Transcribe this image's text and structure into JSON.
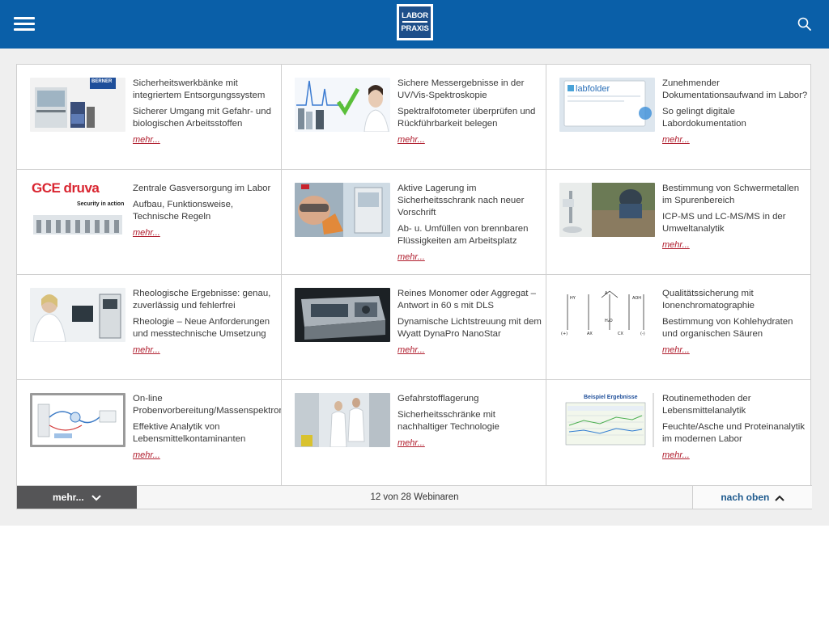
{
  "header": {
    "menu_icon": "hamburger-menu-icon",
    "logo_line1": "LABOR",
    "logo_line2": "PRAXIS",
    "search_icon": "search-icon",
    "color": "#0a5fa8"
  },
  "webinars": [
    {
      "title": "Sicherheitswerkbänke mit integriertem Entsorgungssystem",
      "subtitle": "Sicherer Umgang mit Gefahr- und biologischen Arbeitsstoffen",
      "more": "mehr...",
      "image_badge": "BERNER"
    },
    {
      "title": "Sichere Messergebnisse in der UV/Vis-Spektroskopie",
      "subtitle": "Spektralfotometer überprüfen und Rückführbarkeit belegen",
      "more": "mehr..."
    },
    {
      "title": "Zunehmender Dokumentationsaufwand im Labor?",
      "subtitle": "So gelingt digitale Labordokumentation",
      "more": "mehr...",
      "image_badge": "labfolder"
    },
    {
      "title": "Zentrale Gasversorgung im Labor",
      "subtitle": "Aufbau, Funktionsweise, Technische Regeln",
      "more": "mehr...",
      "image_badge": "GCE druva",
      "image_tagline": "Security in action"
    },
    {
      "title": "Aktive Lagerung im Sicherheitsschrank nach neuer Vorschrift",
      "subtitle": "Ab- u. Umfüllen von brennbaren Flüssigkeiten am Arbeitsplatz",
      "more": "mehr..."
    },
    {
      "title": "Bestimmung von Schwermetallen im Spurenbereich",
      "subtitle": "ICP-MS und LC-MS/MS in der Umweltanalytik",
      "more": "mehr..."
    },
    {
      "title": "Rheologische Ergebnisse: genau, zuverlässig und fehlerfrei",
      "subtitle": "Rheologie – Neue Anforderungen und messtechnische Umsetzung",
      "more": "mehr..."
    },
    {
      "title": "Reines Monomer oder Aggregat – Antwort in 60 s mit DLS",
      "subtitle": "Dynamische Lichtstreuung mit dem Wyatt DynaPro NanoStar",
      "more": "mehr..."
    },
    {
      "title": "Qualitätssicherung mit Ionenchromatographie",
      "subtitle": "Bestimmung von Kohlehydraten und organischen Säuren",
      "more": "mehr..."
    },
    {
      "title": "On-line Probenvorbereitung/Massenspektrometrie",
      "subtitle": "Effektive Analytik von Lebensmittelkontaminanten",
      "more": "mehr..."
    },
    {
      "title": "Gefahrstofflagerung",
      "subtitle": "Sicherheitsschränke mit nachhaltiger Technologie",
      "more": "mehr..."
    },
    {
      "title": "Routinemethoden der Lebensmittelanalytik",
      "subtitle": "Feuchte/Asche und Proteinanalytik im modernen Labor",
      "more": "mehr...",
      "image_badge": "Beispiel Ergebnisse"
    }
  ],
  "footer": {
    "more_label": "mehr...",
    "count_text": "12 von 28 Webinaren",
    "top_label": "nach oben"
  }
}
